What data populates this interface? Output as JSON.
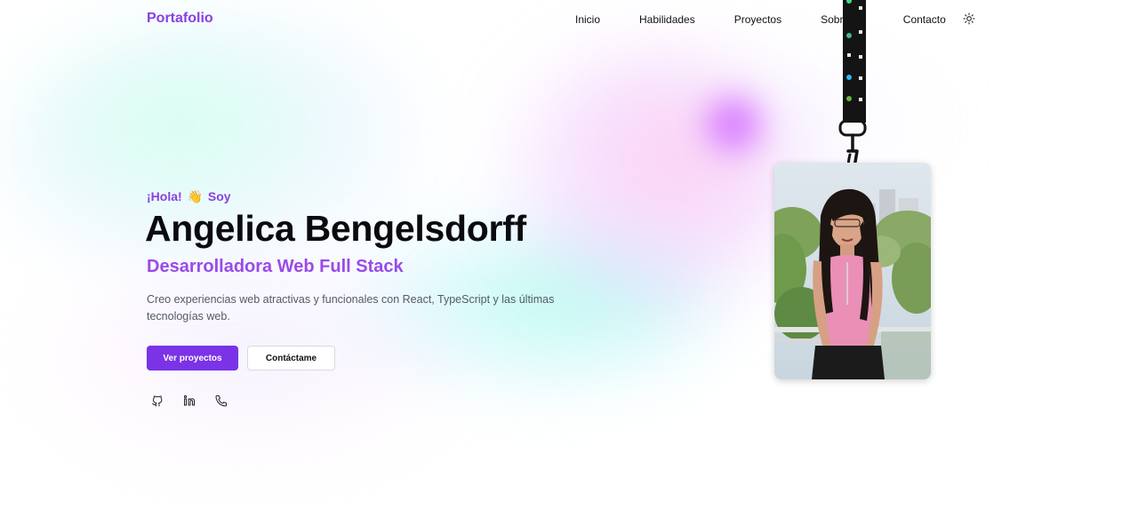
{
  "header": {
    "logo": "Portafolio",
    "nav": [
      {
        "label": "Inicio",
        "name": "nav-inicio"
      },
      {
        "label": "Habilidades",
        "name": "nav-habilidades"
      },
      {
        "label": "Proyectos",
        "name": "nav-proyectos"
      },
      {
        "label": "Sobre mí",
        "name": "nav-sobre-mi"
      },
      {
        "label": "Contacto",
        "name": "nav-contacto"
      }
    ],
    "theme_icon": "sun-icon"
  },
  "hero": {
    "greeting_prefix": "¡Hola!",
    "greeting_emoji": "👋",
    "greeting_suffix": "Soy",
    "name": "Angelica Bengelsdorff",
    "role": "Desarrolladora Web Full Stack",
    "description": "Creo experiencias web atractivas y funcionales con React, TypeScript y las últimas tecnologías web.",
    "primary_button": "Ver proyectos",
    "secondary_button": "Contáctame",
    "social_icons": [
      "github-icon",
      "linkedin-icon",
      "phone-icon"
    ]
  },
  "badge": {
    "photo_alt": "profile-photo",
    "lanyard_icons": [
      "node-icon",
      "vue-icon",
      "react-icon",
      "spring-icon"
    ]
  },
  "colors": {
    "accent": "#7a33e6",
    "logo": "#8a3fe3",
    "role": "#9b4ae8",
    "text": "#0b0b0f",
    "muted": "#555a66"
  }
}
